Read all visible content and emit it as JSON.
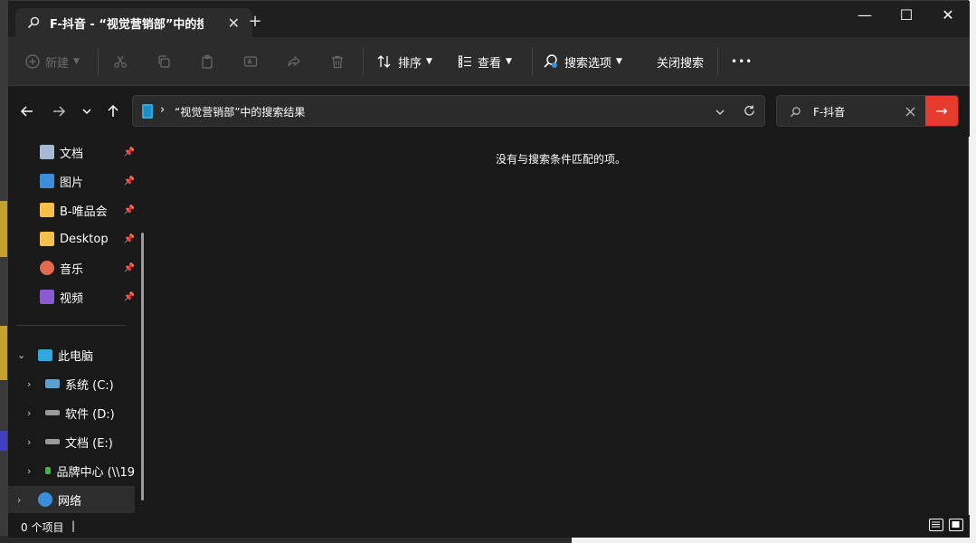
{
  "window": {
    "tab_title": "F-抖音 - “视觉营销部”中的搜索",
    "tab_icon": "search-icon",
    "tab_close": "✕",
    "new_tab": "+",
    "controls": {
      "minimize": "—",
      "maximize": "☐",
      "close": "✕"
    }
  },
  "toolbar": {
    "new_label": "新建",
    "sort_label": "排序",
    "view_label": "查看",
    "search_options_label": "搜索选项",
    "close_search_label": "关闭搜索",
    "more": "•••"
  },
  "address_bar": {
    "path": "“视觉营销部”中的搜索结果",
    "caret": "›"
  },
  "search_box": {
    "value": "F-抖音",
    "go": "→"
  },
  "sidebar": {
    "quick_access": [
      {
        "label": "文档",
        "icon": "documents-icon",
        "color": "#a8b8d0"
      },
      {
        "label": "图片",
        "icon": "pictures-icon",
        "color": "#3a8fd8"
      },
      {
        "label": "B-唯品会",
        "icon": "folder-icon",
        "color": "#f5c04a"
      },
      {
        "label": "Desktop",
        "icon": "folder-icon",
        "color": "#f5c04a"
      },
      {
        "label": "音乐",
        "icon": "music-icon",
        "color": "#e06a50"
      },
      {
        "label": "视频",
        "icon": "videos-icon",
        "color": "#8a5ad0"
      }
    ],
    "this_pc": "此电脑",
    "drives": [
      {
        "label": "系统 (C:)",
        "icon": "system-drive-icon"
      },
      {
        "label": "软件 (D:)",
        "icon": "drive-icon"
      },
      {
        "label": "文档 (E:)",
        "icon": "drive-icon"
      },
      {
        "label": "品牌中心 (\\\\19",
        "icon": "network-drive-icon"
      }
    ],
    "network": "网络"
  },
  "content": {
    "empty_message": "没有与搜索条件匹配的项。"
  },
  "status": {
    "count": "0 个项目",
    "cursor": "|"
  },
  "colors": {
    "accent_red": "#e63c2e",
    "window_bg": "#191919",
    "toolbar_bg": "#2c2c2c"
  }
}
